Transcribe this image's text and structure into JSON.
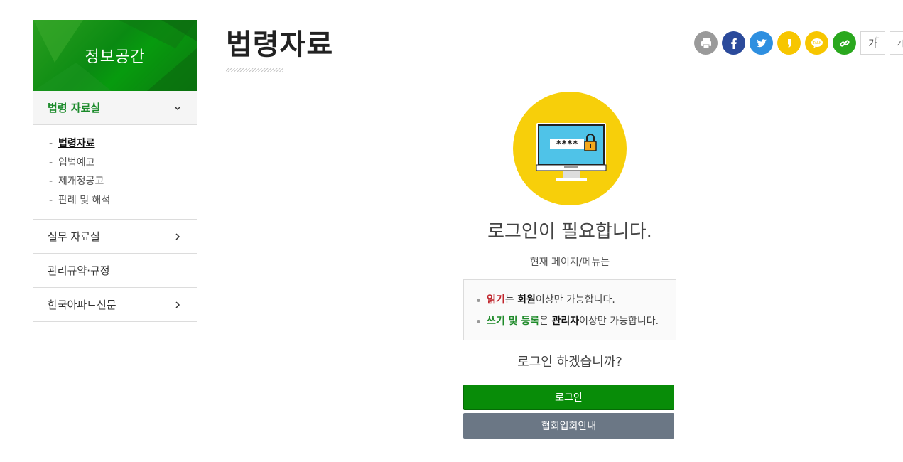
{
  "sidebar": {
    "title": "정보공간",
    "menu": [
      {
        "label": "법령 자료실",
        "expanded": true,
        "children": [
          "법령자료",
          "입법예고",
          "제개정공고",
          "판례 및 해석"
        ]
      },
      {
        "label": "실무 자료실"
      },
      {
        "label": "관리규약·규정"
      },
      {
        "label": "한국아파트신문"
      }
    ]
  },
  "page": {
    "title": "법령자료"
  },
  "share": {
    "icons": [
      "print-icon",
      "facebook-icon",
      "twitter-icon",
      "kakaostory-icon",
      "kakaotalk-icon",
      "link-icon"
    ],
    "colors": {
      "print": "#9a9a9a",
      "facebook": "#2b4a9b",
      "twitter": "#2e8fe0",
      "kakaostory": "#f7c600",
      "kakaotalk": "#f7c600",
      "link": "#2aa81e"
    },
    "font_increase": "가",
    "font_decrease": "가",
    "font_increase_sup": "+"
  },
  "login_prompt": {
    "password_mask": "****",
    "heading": "로그인이 필요합니다.",
    "subtext": "현재 페이지/메뉴는",
    "rules": [
      {
        "a": "읽기",
        "b": "는 ",
        "c": "회원",
        "d": "이상만 가능합니다."
      },
      {
        "a": "쓰기 및 등록",
        "b": "은 ",
        "c": "관리자",
        "d": "이상만 가능합니다."
      }
    ],
    "question": "로그인 하겠습니까?",
    "login_button": "로그인",
    "join_button": "협회입회안내"
  },
  "colors": {
    "accent": "#088c08",
    "secondary_button": "#6b7785",
    "lock_bg": "#f7cf0a"
  }
}
